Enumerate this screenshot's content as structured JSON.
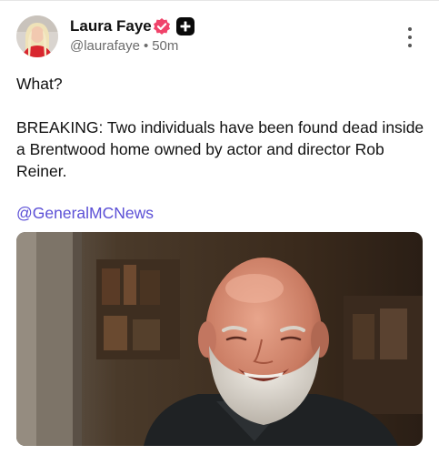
{
  "author": {
    "display_name": "Laura Faye",
    "handle": "@laurafaye",
    "separator": "•",
    "time_ago": "50m"
  },
  "post": {
    "line1": "What?",
    "line2": "BREAKING: Two individuals have been found dead inside a Brentwood home owned by actor and director Rob Reiner.",
    "mention": "@GeneralMCNews"
  },
  "icons": {
    "verified": "verified-badge-icon",
    "plus": "plus-badge-icon",
    "more": "more-vertical-icon"
  },
  "colors": {
    "verified_badge": "#f0436a",
    "mention_link": "#5b4fd6",
    "handle_text": "#6b6b6b"
  }
}
